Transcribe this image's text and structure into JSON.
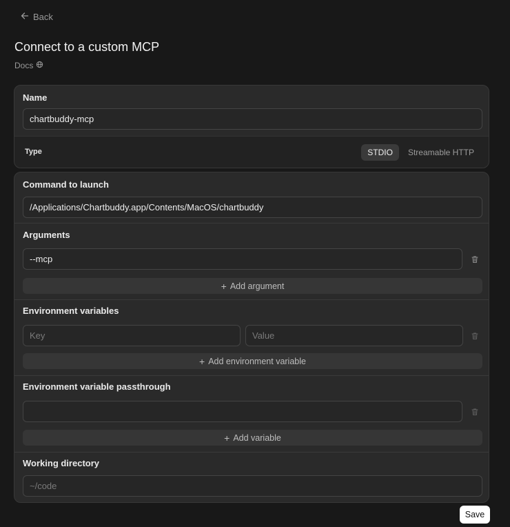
{
  "nav": {
    "back_label": "Back"
  },
  "header": {
    "title": "Connect to a custom MCP",
    "docs_label": "Docs"
  },
  "name_section": {
    "label": "Name",
    "value": "chartbuddy-mcp"
  },
  "type_section": {
    "label": "Type",
    "options": [
      {
        "label": "STDIO",
        "selected": true
      },
      {
        "label": "Streamable HTTP",
        "selected": false
      }
    ]
  },
  "command_section": {
    "label": "Command to launch",
    "value": "/Applications/Chartbuddy.app/Contents/MacOS/chartbuddy"
  },
  "arguments_section": {
    "label": "Arguments",
    "items": [
      "--mcp"
    ],
    "add_label": "Add argument"
  },
  "env_section": {
    "label": "Environment variables",
    "key_placeholder": "Key",
    "value_placeholder": "Value",
    "add_label": "Add environment variable"
  },
  "passthrough_section": {
    "label": "Environment variable passthrough",
    "value": "",
    "add_label": "Add variable"
  },
  "workdir_section": {
    "label": "Working directory",
    "placeholder": "~/code"
  },
  "footer": {
    "save_label": "Save"
  },
  "colors": {
    "background": "#181818",
    "card": "#2a2a2a",
    "accent_button": "#ffffff"
  }
}
